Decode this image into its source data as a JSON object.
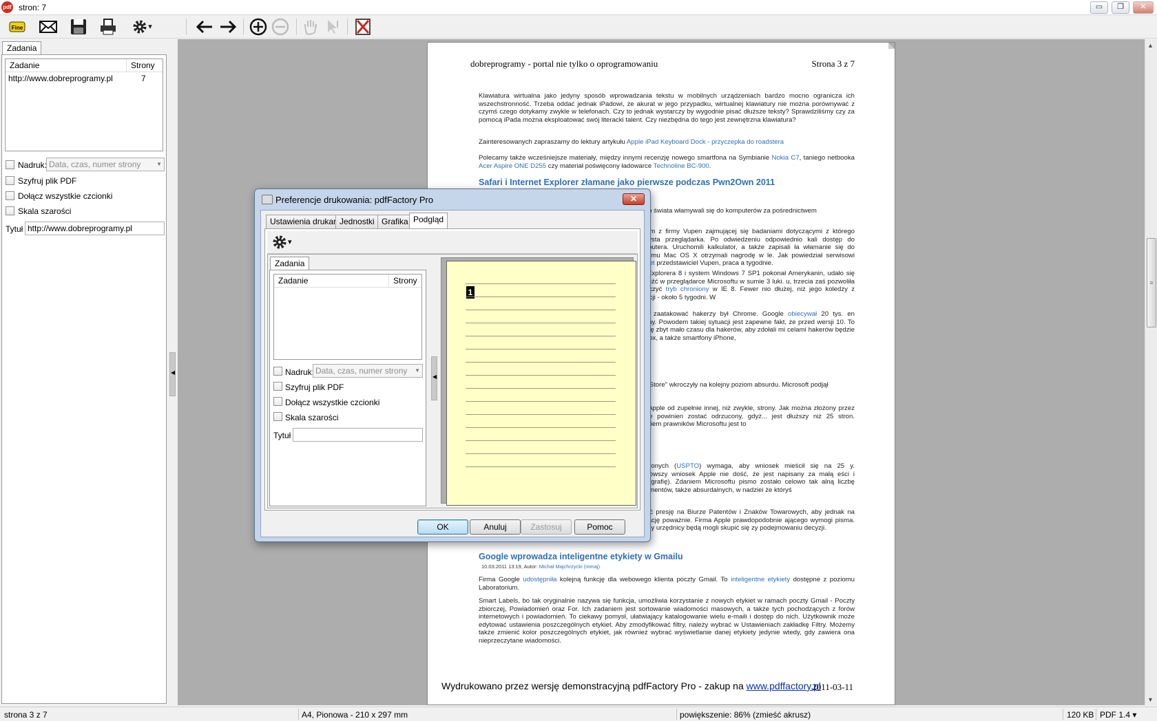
{
  "window": {
    "title": "stron: 7",
    "app_icon": "pdf",
    "controls": {
      "minimize": "▭",
      "maximize": "❐",
      "close": "✕"
    }
  },
  "toolbar": {
    "icons": [
      "fine-print-icon",
      "email-icon",
      "save-icon",
      "print-icon",
      "settings-icon",
      "back-arrow-icon",
      "forward-arrow-icon",
      "zoom-in-icon",
      "zoom-out-icon",
      "hand-icon",
      "select-icon",
      "close-document-icon"
    ],
    "fine_label": "Fine",
    "dropdown_glyph": "▾"
  },
  "left_panel": {
    "tab": "Zadania",
    "columns": {
      "task": "Zadanie",
      "pages": "Strony"
    },
    "rows": [
      {
        "task": "http://www.dobreprogramy.pl",
        "pages": "7"
      }
    ],
    "imprint_label": "Nadruk:",
    "imprint_placeholder": "Data, czas, numer strony",
    "encrypt_label": "Szyfruj plik PDF",
    "embed_fonts_label": "Dołącz wszystkie czcionki",
    "grayscale_label": "Skala szarości",
    "title_label": "Tytuł",
    "title_value": "http://www.dobreprogramy.pl"
  },
  "document": {
    "header_left": "dobreprogramy - portal nie tylko o oprogramowaniu",
    "header_right": "Strona 3 z 7",
    "p1": "Klawiatura wirtualna jako jedyny sposób wprowadzania tekstu w mobilnych urządzeniach bardzo mocno ogranicza ich wszechstronność. Trzeba oddać jednak iPadowi, że akurat w jego przypadku, wirtualnej klawiatury nie można porównywać z czymś czego dotykamy zwykle w telefonach. Czy to jednak wystarczy by wygodnie pisać dłuższe teksty? Sprawdziliśmy czy za pomocą iPada można eksploatować swój literacki talent. Czy niezbędna do tego jest zewnętrzna klawiatura?",
    "p2_text": "Zainteresowanych zapraszamy do lektury artykułu",
    "p2_link": "Apple iPad Keyboard Dock - przyczepka do roadstera",
    "p3_a": "Polecamy także wcześniejsze materiały, między innymi recenzję nowego smartfona na Symbianie",
    "p3_link1": "Nokia C7",
    "p3_b": ", taniego netbooka",
    "p3_link2": "Acer Aspire ONE D255",
    "p3_c": "czy materiał poświęcony ładowarce",
    "p3_link3": "Technoline BC-900",
    "heading1": "Safari i Internet Explorer złamane jako pierwsze podczas Pwn2Own 2011",
    "frag1": "ałego świata włamywali się do komputerów za pośrednictwem",
    "frag2": "cuzom z firmy Vupen zajmującej się badaniami dotyczącymi z którego korzysta przeglądarka. Po odwiedzeniu odpowiednio kali dostęp do komputera. Uruchomili kalkulator, a także zapisali ła włamanie się do systemu Mac OS X otrzymali nagrodę w le. Jak powiedział serwisowi",
    "frag2_link": "ZDNet",
    "frag2_b": "przedstawiciel Vupen, praca a tygodnie.",
    "frag3": "net Explorera 8 i system Windows 7 SP1 pokonał Amerykanin, udało się znaleźć w przeglądarce Microsoftu w sumie 3 luki. u, trzecia zaś pozwoliła wyłączyć",
    "frag3_link": "tryb chroniony",
    "frag3_b": "w IE 8. Fewer nio dłużej, niż jego koledzy z Francji - około 5 tygodni. W",
    "frag4_a": "mieli zaatakować hakerzy był Chrome. Google",
    "frag4_link": "obiecywał",
    "frag4_b": "20 tys. en chętny. Powodem takiej sytuacji jest zapewne fakt, że przed wersji 10. To trochę zbyt mało czasu dla hakerów, aby zdołali mi celami hakerów będzie Firefox, a także smartfony iPhone,",
    "frag5": "App Store\" wkroczyły na kolejny poziom absurdu. Microsoft podjął",
    "frag6": "ki z Apple od zupełnie innej, niż zwykle, strony. Jak można złożony przez Apple powinien zostać odrzucony, gdyż... jest dłuższy niż 25 stron. Zdaniem prawników Microsoftu jest to",
    "frag7_a": "nioczonych (",
    "frag7_link": "USPTO",
    "frag7_b": ") wymaga, aby wniosek mieścił się na 25 y. Najnowszy wniosek Apple nie dość, że jest napisany za małą eści i bibliografię). Zdaniem Microsoftu pismo zostało celowo tak alną liczbę argumentów, także absurdalnych, w nadziei że któryś",
    "frag8": "wrzeć presję na Biurze Patentów i Znaków Towarowych, aby jednak na sytuację poważnie. Firma Apple prawdopodobnie ającego wymogi pisma. Wtedy urzędnicy będą mogli skupić się zy podejmowaniu decyzji.",
    "heading2": "Google wprowadza inteligentne etykiety w Gmailu",
    "meta": "10.03.2011 13:19, Autor:",
    "meta_author": "Michał Majchrzycki (mmaj)",
    "p_g1_a": "Firma Google",
    "p_g1_link1": "udostępniła",
    "p_g1_b": "kolejną funkcję dla webowego klienta poczty Gmail. To",
    "p_g1_link2": "inteligentne etykiety",
    "p_g1_c": "dostępne z poziomu Laboratorium.",
    "p_g2": "Smart Labels, bo tak oryginalnie nazywa się funkcja, umożliwia korzystanie z nowych etykiet w ramach poczty Gmail - Poczty zbiorczej, Powiadomień oraz For. Ich zadaniem jest sortowanie wiadomości masowych, a także tych pochodzących z forów internetowych i powiadomień. To ciekawy pomysł, ułatwiający katalogowanie wielu e-maili i dostęp do nich. Użytkownik może edytować ustawienia poszczególnych etykiet. Aby zmodyfikować filtry, należy wybrać w Ustawieniach zakładkę Filtry. Możemy także zmienić kolor poszczególnych etykiet, jak również wybrać wyświetlanie danej etykiety jedynie wtedy, gdy zawiera ona nieprzeczytane wiadomości.",
    "watermark_text": "Wydrukowano przez wersję demonstracyjną pdfFactory Pro - zakup na",
    "watermark_link": "www.pdffactory.pl",
    "footer_date": "2011-03-11"
  },
  "scrollbar": {
    "up": "▲",
    "down": "▼",
    "grip": "≡"
  },
  "statusbar": {
    "page": "strona 3 z 7",
    "paper": "A4, Pionowa - 210 x 297 mm",
    "zoom": "powiększenie: 86% (zmieść akrusz)",
    "size": "120 KB",
    "pdf_version": "PDF 1.4 ▾"
  },
  "dialog": {
    "title": "Preferencje drukowania: pdfFactory Pro",
    "close": "✕",
    "tabs": [
      "Ustawienia drukarki",
      "Jednostki",
      "Grafika",
      "Podgląd"
    ],
    "active_tab": 3,
    "inner_tab": "Zadania",
    "columns": {
      "task": "Zadanie",
      "pages": "Strony"
    },
    "imprint_label": "Nadruk:",
    "imprint_placeholder": "Data, czas, numer strony",
    "encrypt_label": "Szyfruj plik PDF",
    "embed_fonts_label": "Dołącz wszystkie czcionki",
    "grayscale_label": "Skala szarości",
    "title_label": "Tytuł",
    "title_value": "",
    "preview_page_number": "1",
    "preview_line_count": 15,
    "buttons": {
      "ok": "OK",
      "cancel": "Anuluj",
      "apply": "Zastosuj",
      "help": "Pomoc"
    }
  }
}
